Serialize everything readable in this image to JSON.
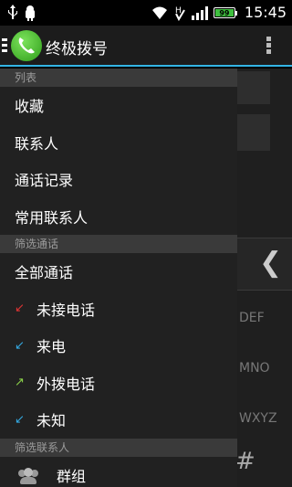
{
  "status_bar": {
    "time": "15:45",
    "battery": "99"
  },
  "action_bar": {
    "title": "终极拨号"
  },
  "drawer": {
    "section_list": "列表",
    "list_items": [
      "收藏",
      "联系人",
      "通话记录",
      "常用联系人"
    ],
    "section_filter_calls": "筛选通话",
    "call_filters": [
      {
        "label": "全部通话",
        "icon": ""
      },
      {
        "label": "未接电话",
        "icon": "missed-call-icon",
        "arrow": "↙",
        "color": "#e03434"
      },
      {
        "label": "来电",
        "icon": "incoming-call-icon",
        "arrow": "↙",
        "color": "#34a8e0"
      },
      {
        "label": "外拨电话",
        "icon": "outgoing-call-icon",
        "arrow": "↗",
        "color": "#8ad04a"
      },
      {
        "label": "未知",
        "icon": "unknown-call-icon",
        "arrow": "↙",
        "color": "#34a8e0"
      }
    ],
    "section_filter_contacts": "筛选联系人",
    "contact_filters": [
      {
        "label": "群组",
        "icon": "group-icon"
      }
    ]
  },
  "background": {
    "keys": [
      "DEF",
      "MNO",
      "WXYZ",
      "#"
    ]
  }
}
